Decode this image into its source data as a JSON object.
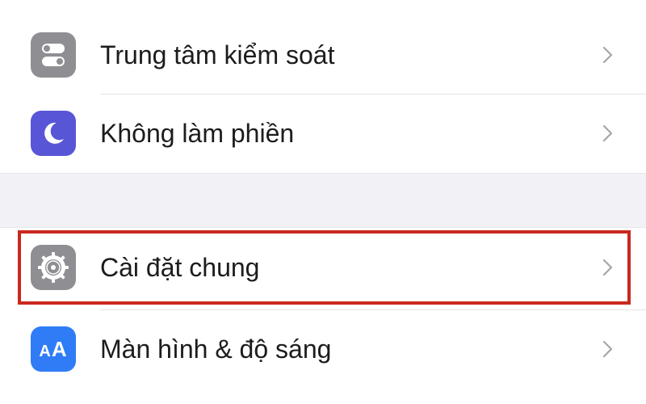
{
  "settings": {
    "items": [
      {
        "label": "Trung tâm kiểm soát",
        "icon": "control-center-icon",
        "icon_color": "#8e8e93"
      },
      {
        "label": "Không làm phiền",
        "icon": "moon-icon",
        "icon_color": "#5856d6"
      },
      {
        "label": "Cài đặt chung",
        "icon": "gear-icon",
        "icon_color": "#8e8e93",
        "highlighted": true
      },
      {
        "label": "Màn hình & độ sáng",
        "icon": "display-brightness-icon",
        "icon_color": "#2f7cf6",
        "icon_text": "AA"
      }
    ],
    "highlight_color": "#c9281e"
  }
}
